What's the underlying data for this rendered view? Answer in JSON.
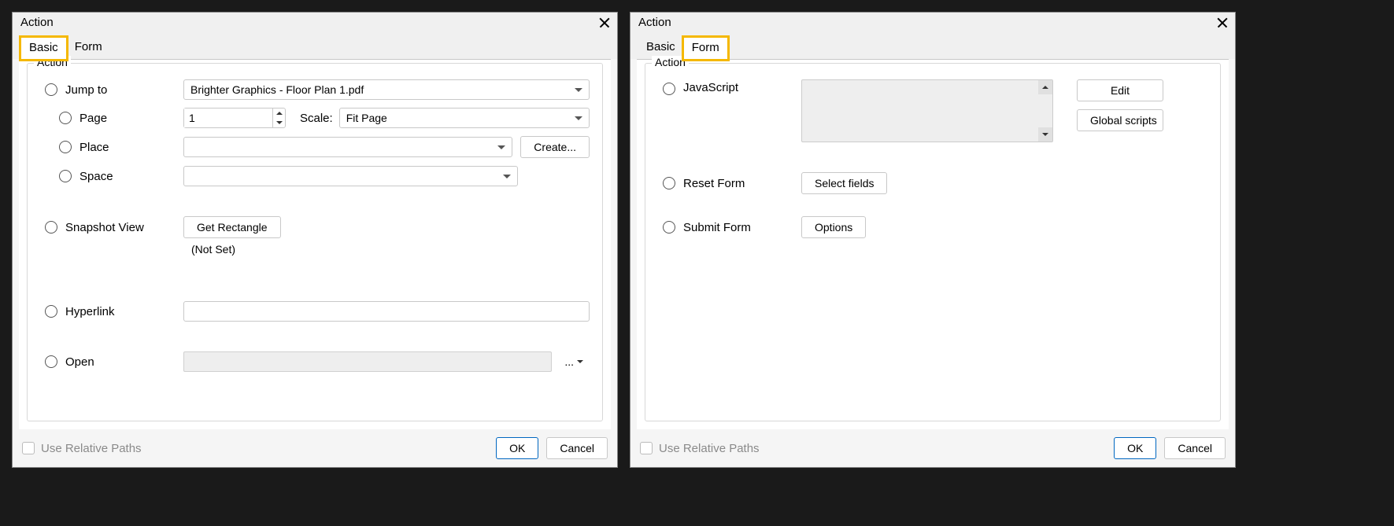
{
  "left": {
    "title": "Action",
    "tabs": {
      "basic": "Basic",
      "form": "Form"
    },
    "group": "Action",
    "jump_to": "Jump to",
    "jump_file": "Brighter Graphics - Floor Plan 1.pdf",
    "page": "Page",
    "page_val": "1",
    "scale": "Scale:",
    "scale_val": "Fit Page",
    "place": "Place",
    "create": "Create...",
    "space": "Space",
    "snapshot": "Snapshot View",
    "get_rect": "Get Rectangle",
    "not_set": "(Not Set)",
    "hyperlink": "Hyperlink",
    "open": "Open",
    "browse": "...",
    "use_rel": "Use Relative Paths",
    "ok": "OK",
    "cancel": "Cancel"
  },
  "right": {
    "title": "Action",
    "tabs": {
      "basic": "Basic",
      "form": "Form"
    },
    "group": "Action",
    "javascript": "JavaScript",
    "edit": "Edit",
    "global": "Global scripts",
    "reset": "Reset Form",
    "select_fields": "Select fields",
    "submit": "Submit Form",
    "options": "Options",
    "use_rel": "Use Relative Paths",
    "ok": "OK",
    "cancel": "Cancel"
  }
}
